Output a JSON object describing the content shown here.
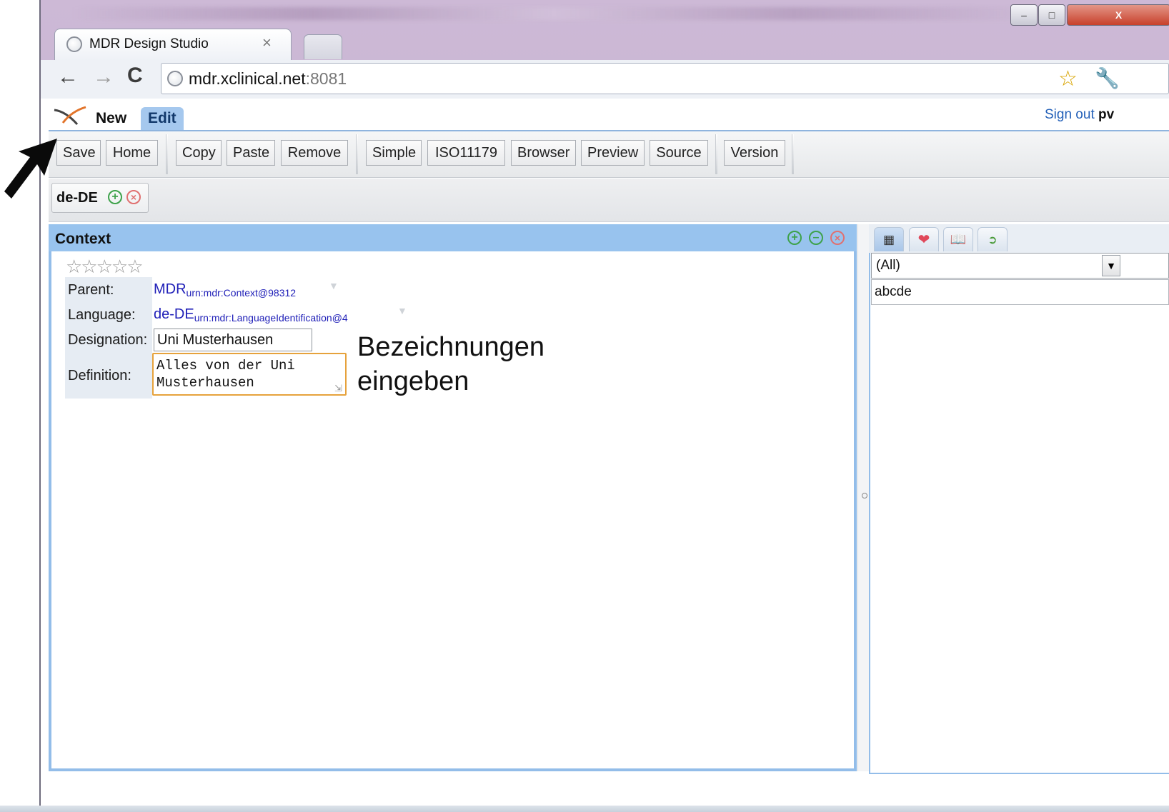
{
  "browser": {
    "tab_title": "MDR Design Studio",
    "tab_close": "×",
    "url_host": "mdr.xclinical.net",
    "url_port": ":8081",
    "win_min": "–",
    "win_max": "□",
    "win_close": "X"
  },
  "app": {
    "menu_tabs": [
      "New",
      "Edit"
    ],
    "sign_out": "Sign out",
    "user": "pv",
    "buttons": {
      "save": "Save",
      "home": "Home",
      "copy": "Copy",
      "paste": "Paste",
      "remove": "Remove",
      "simple": "Simple",
      "iso": "ISO11179",
      "browser": "Browser",
      "preview": "Preview",
      "source": "Source",
      "version": "Version"
    },
    "language_tag": "de-DE"
  },
  "panel": {
    "title": "Context",
    "rating_stars": 0,
    "stars_text": "☆☆☆☆☆",
    "fields": {
      "parent_label": "Parent:",
      "parent_value": "MDR",
      "parent_urn": "urn:mdr:Context@98312",
      "language_label": "Language:",
      "language_value": "de-DE",
      "language_urn": "urn:mdr:LanguageIdentification@4",
      "designation_label": "Designation:",
      "designation_value": "Uni Musterhausen",
      "definition_label": "Definition:",
      "definition_value": "Alles von der Uni\nMusterhausen"
    },
    "annotation": "Bezeichnungen\neingeben"
  },
  "right_panel": {
    "filter_selected": "(All)",
    "search_value": "abcde",
    "tabs": [
      "structure-icon",
      "heart-icon",
      "book-icon",
      "export-icon"
    ]
  },
  "colors": {
    "accent_blue": "#98c3ee",
    "link_blue": "#2020b8",
    "focus_orange": "#e6a23c"
  }
}
